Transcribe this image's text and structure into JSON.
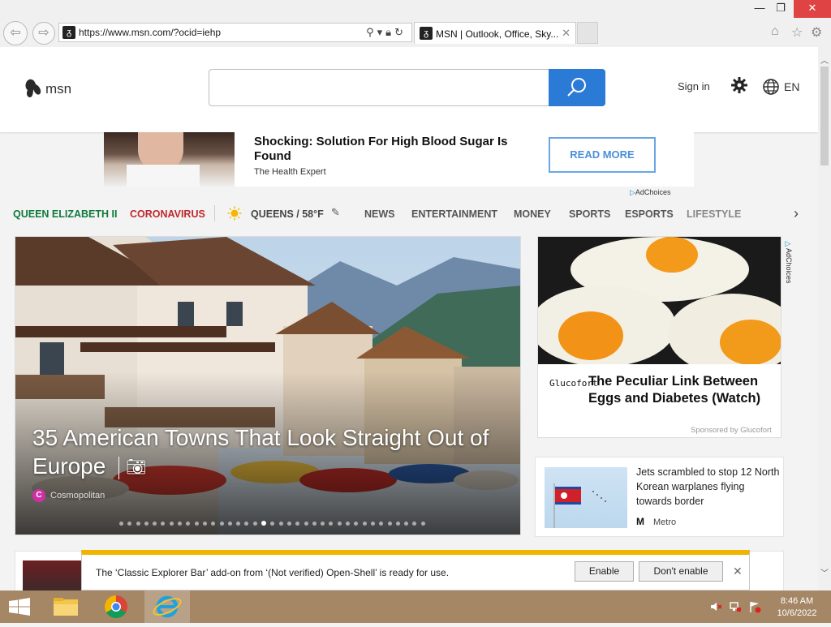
{
  "browser": {
    "url": "https://www.msn.com/?ocid=iehp",
    "tab_title": "MSN | Outlook, Office, Sky...",
    "window_controls": {
      "minimize": "—",
      "maximize": "❐",
      "close": "✕"
    }
  },
  "msn_header": {
    "logo_text": "msn",
    "search_placeholder": "",
    "signin_label": "Sign in",
    "language": "EN"
  },
  "top_ad": {
    "headline": "Shocking: Solution For High Blood Sugar Is Found",
    "source": "The Health Expert",
    "cta": "READ MORE",
    "adchoices": "AdChoices"
  },
  "nav": {
    "items": [
      "QUEEN ELIZABETH II",
      "CORONAVIRUS",
      "QUEENS / 58°F",
      "NEWS",
      "ENTERTAINMENT",
      "MONEY",
      "SPORTS",
      "ESPORTS",
      "LIFESTYLE"
    ],
    "colors": {
      "queen": "#0e7a3d",
      "coronavirus": "#c0282d"
    }
  },
  "hero": {
    "title": "35 American Towns That Look Straight Out of Europe",
    "source_badge": "C",
    "source": "Cosmopolitan",
    "slide_count": 37,
    "active_slide": 17
  },
  "ad_card": {
    "brand": "Glucofort",
    "headline": "The Peculiar Link Between Eggs and Diabetes (Watch)",
    "sponsored": "Sponsored by Glucofort",
    "adchoices": "AdChoices"
  },
  "news_card": {
    "headline": "Jets scrambled to stop 12 North Korean warplanes flying towards border",
    "source_badge": "M",
    "source": "Metro"
  },
  "notification": {
    "text": "The ‘Classic Explorer Bar’ add-on from ‘(Not verified) Open-Shell’ is ready for use.",
    "enable_label": "Enable",
    "dont_enable_label": "Don't enable",
    "close": "✕"
  },
  "taskbar": {
    "time": "8:46 AM",
    "date": "10/6/2022"
  }
}
